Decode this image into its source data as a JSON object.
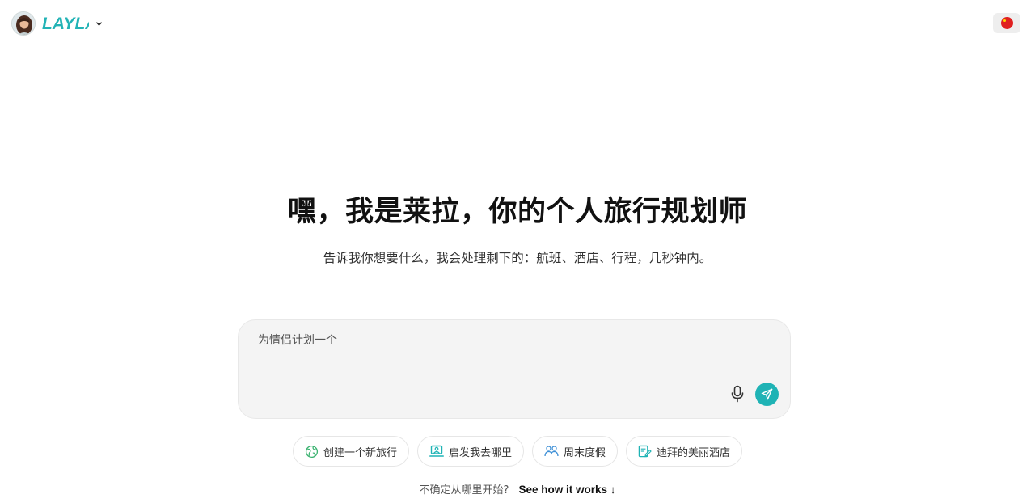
{
  "header": {
    "brand_name": "LAYLA",
    "brand_chevron_icon": "chevron-down-icon",
    "avatar_icon": "avatar-portrait",
    "language_flag_icon": "china-flag-icon"
  },
  "hero": {
    "title": "嘿，我是莱拉，你的个人旅行规划师",
    "subtitle": "告诉我你想要什么，我会处理剩下的：航班、酒店、行程，几秒钟内。"
  },
  "prompt": {
    "placeholder": "为情侣计划一个",
    "value": "",
    "mic_icon": "microphone-icon",
    "send_icon": "send-icon",
    "accent_color": "#1fb3b5"
  },
  "suggestions": [
    {
      "label": "创建一个新旅行",
      "icon": "globe-icon",
      "color": "#3cb371"
    },
    {
      "label": "启发我去哪里",
      "icon": "laptop-icon",
      "color": "#1fb3b5"
    },
    {
      "label": "周末度假",
      "icon": "people-icon",
      "color": "#3d8fd6"
    },
    {
      "label": "迪拜的美丽酒店",
      "icon": "edit-icon",
      "color": "#1fb3b5"
    }
  ],
  "footer": {
    "hint_text": "不确定从哪里开始?",
    "link_label": "See how it works ↓"
  }
}
